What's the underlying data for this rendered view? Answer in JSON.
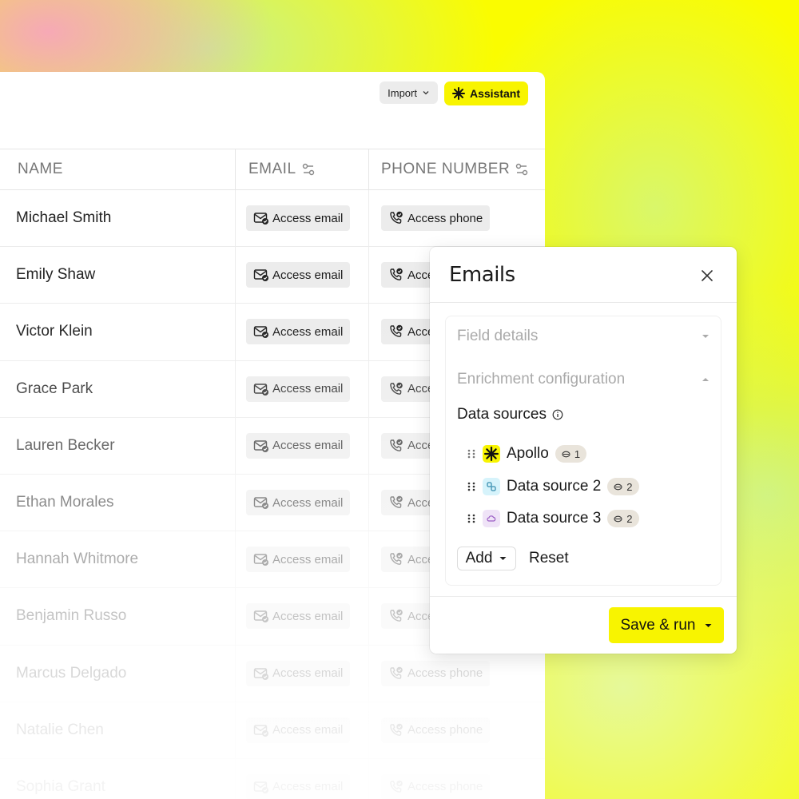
{
  "toolbar": {
    "import_label": "Import",
    "assistant_label": "Assistant"
  },
  "table": {
    "columns": [
      "NAME",
      "EMAIL",
      "PHONE NUMBER"
    ],
    "rows": [
      {
        "name": "Michael Smith",
        "email": "Access email",
        "phone": "Access phone",
        "opacity": 1
      },
      {
        "name": "Emily Shaw",
        "email": "Access email",
        "phone": "Access phone",
        "opacity": 1
      },
      {
        "name": "Victor Klein",
        "email": "Access email",
        "phone": "Access phone",
        "opacity": 1
      },
      {
        "name": "Grace Park",
        "email": "Access email",
        "phone": "Access phone",
        "opacity": 0.92
      },
      {
        "name": "Lauren Becker",
        "email": "Access email",
        "phone": "Access phone",
        "opacity": 0.85
      },
      {
        "name": "Ethan Morales",
        "email": "Access email",
        "phone": "Access phone",
        "opacity": 0.75
      },
      {
        "name": "Hannah Whitmore",
        "email": "Access email",
        "phone": "Access phone",
        "opacity": 0.62
      },
      {
        "name": "Benjamin Russo",
        "email": "Access email",
        "phone": "Access phone",
        "opacity": 0.52
      },
      {
        "name": "Marcus Delgado",
        "email": "Access email",
        "phone": "Access phone",
        "opacity": 0.42
      },
      {
        "name": "Natalie Chen",
        "email": "Access email",
        "phone": "Access phone",
        "opacity": 0.32
      },
      {
        "name": "Sophia Grant",
        "email": "Access email",
        "phone": "Access phone",
        "opacity": 0.24
      }
    ]
  },
  "panel": {
    "title": "Emails",
    "field_details_label": "Field details",
    "enrichment_label": "Enrichment configuration",
    "data_sources_label": "Data sources",
    "sources": [
      {
        "name": "Apollo",
        "count": "1",
        "icon": "apollo-logo-icon",
        "color": "#f8f400"
      },
      {
        "name": "Data source 2",
        "count": "2",
        "icon": "link-logo-icon",
        "color": "#d6f3fb"
      },
      {
        "name": "Data source 3",
        "count": "2",
        "icon": "cloud-logo-icon",
        "color": "#efe3f7"
      }
    ],
    "add_label": "Add",
    "reset_label": "Reset",
    "save_label": "Save & run"
  },
  "colors": {
    "accent": "#f8f400",
    "background": "#fafc00"
  }
}
